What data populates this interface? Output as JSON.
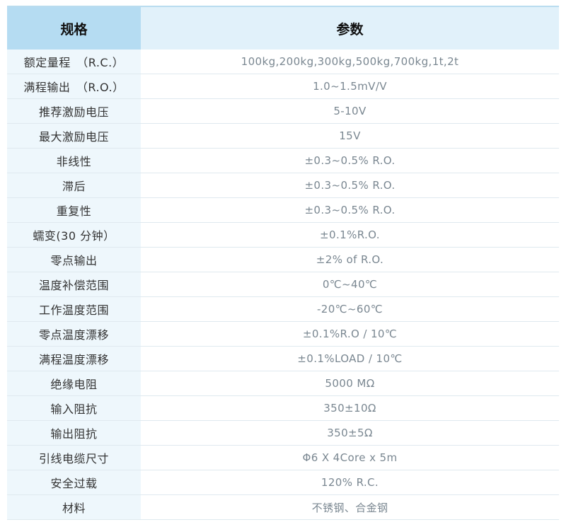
{
  "table": {
    "headers": [
      "规格",
      "参数"
    ],
    "rows": [
      {
        "name": "额定量程　（R.C.）",
        "value": "100kg,200kg,300kg,500kg,700kg,1t,2t"
      },
      {
        "name": "满程输出　（R.O.）",
        "value": "1.0~1.5mV/V"
      },
      {
        "name": "推荐激励电压",
        "value": "5-10V"
      },
      {
        "name": "最大激励电压",
        "value": "15V"
      },
      {
        "name": "非线性",
        "value": "±0.3~0.5% R.O."
      },
      {
        "name": "滞后",
        "value": "±0.3~0.5% R.O."
      },
      {
        "name": "重复性",
        "value": "±0.3~0.5% R.O."
      },
      {
        "name": "蠕变(30 分钟）",
        "value": "±0.1%R.O."
      },
      {
        "name": "零点输出",
        "value": "±2% of R.O."
      },
      {
        "name": "温度补偿范围",
        "value": "0℃~40℃"
      },
      {
        "name": "工作温度范围",
        "value": "-20℃~60℃"
      },
      {
        "name": "零点温度漂移",
        "value": "±0.1%R.O / 10℃"
      },
      {
        "name": "满程温度漂移",
        "value": "±0.1%LOAD / 10℃"
      },
      {
        "name": "绝缘电阻",
        "value": "5000 MΩ"
      },
      {
        "name": "输入阻抗",
        "value": "350±10Ω"
      },
      {
        "name": "输出阻抗",
        "value": "350±5Ω"
      },
      {
        "name": "引线电缆尺寸",
        "value": "Φ6 X 4Core x 5m"
      },
      {
        "name": "安全过载",
        "value": "120% R.C."
      },
      {
        "name": "材料",
        "value": "不锈钢、合金钢"
      }
    ]
  }
}
